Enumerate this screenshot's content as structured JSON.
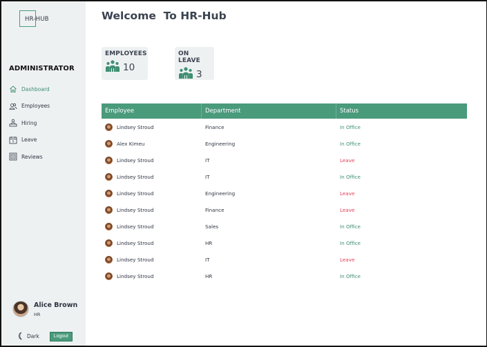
{
  "app": {
    "logo": "HR-HUB",
    "role": "ADMINISTRATOR",
    "title": "Welcome  To HR-Hub"
  },
  "sidebar": {
    "items": [
      {
        "label": "Dashboard",
        "icon": "home-icon",
        "active": true
      },
      {
        "label": "Employees",
        "icon": "users-icon",
        "active": false
      },
      {
        "label": "Hiring",
        "icon": "hiring-icon",
        "active": false
      },
      {
        "label": "Leave",
        "icon": "calendar-icon",
        "active": false
      },
      {
        "label": "Reviews",
        "icon": "review-icon",
        "active": false
      }
    ]
  },
  "profile": {
    "name": "Alice Brown",
    "dept": "HR"
  },
  "footer": {
    "dark_label": "Dark",
    "logout_label": "Logout"
  },
  "stats": [
    {
      "label": "EMPLOYEES",
      "value": "10",
      "icon": "group-icon"
    },
    {
      "label": "ON LEAVE",
      "value": "3",
      "icon": "group-icon"
    }
  ],
  "table": {
    "headers": [
      "Employee",
      "Department",
      "Status"
    ],
    "rows": [
      {
        "name": "Lindsey Stroud",
        "department": "Finance",
        "status": "In Office"
      },
      {
        "name": "Alex Kimeu",
        "department": "Engineering",
        "status": "In Office"
      },
      {
        "name": "Lindsey Stroud",
        "department": "IT",
        "status": "Leave"
      },
      {
        "name": "Lindsey Stroud",
        "department": "IT",
        "status": "In Office"
      },
      {
        "name": "Lindsey Stroud",
        "department": "Engineering",
        "status": "Leave"
      },
      {
        "name": "Lindsey Stroud",
        "department": "Finance",
        "status": "Leave"
      },
      {
        "name": "Lindsey Stroud",
        "department": "Sales",
        "status": "In Office"
      },
      {
        "name": "Lindsey Stroud",
        "department": "HR",
        "status": "In Office"
      },
      {
        "name": "Lindsey Stroud",
        "department": "IT",
        "status": "Leave"
      },
      {
        "name": "Lindsey Stroud",
        "department": "HR",
        "status": "In Office"
      }
    ]
  },
  "colors": {
    "accent": "#4a9a7c",
    "in_office": "#3f8f72",
    "leave": "#e0405a",
    "sidebar_bg": "#eef1f2"
  }
}
